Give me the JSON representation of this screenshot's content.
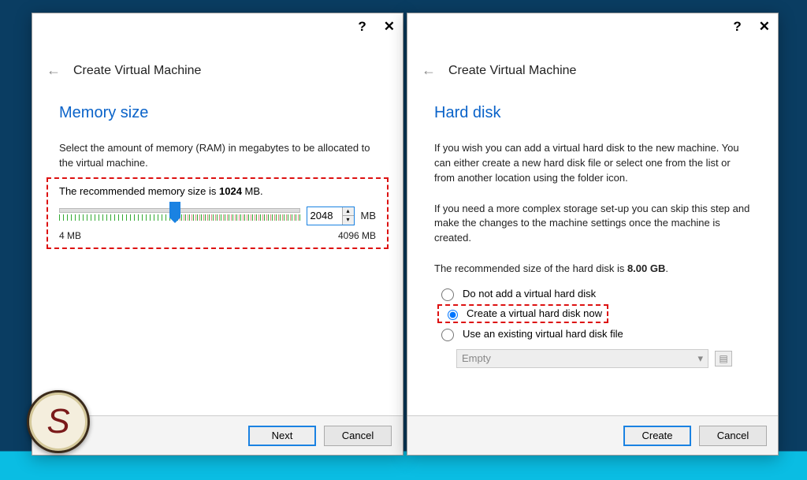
{
  "left": {
    "wizard_title": "Create Virtual Machine",
    "section_title": "Memory size",
    "instruction": "Select the amount of memory (RAM) in megabytes to be allocated to the virtual machine.",
    "recommended_prefix": "The recommended memory size is ",
    "recommended_value": "1024",
    "recommended_suffix": " MB.",
    "memory_value": "2048",
    "memory_unit": "MB",
    "slider_min": "4 MB",
    "slider_max": "4096 MB",
    "btn_next": "Next",
    "btn_cancel": "Cancel"
  },
  "right": {
    "wizard_title": "Create Virtual Machine",
    "section_title": "Hard disk",
    "para1": "If you wish you can add a virtual hard disk to the new machine. You can either create a new hard disk file or select one from the list or from another location using the folder icon.",
    "para2": "If you need a more complex storage set-up you can skip this step and make the changes to the machine settings once the machine is created.",
    "rec_prefix": "The recommended size of the hard disk is ",
    "rec_value": "8.00 GB",
    "rec_suffix": ".",
    "opt_none": "Do not add a virtual hard disk",
    "opt_create": "Create a virtual hard disk now",
    "opt_existing": "Use an existing virtual hard disk file",
    "existing_selected": "Empty",
    "btn_create": "Create",
    "btn_cancel": "Cancel"
  },
  "titlebar": {
    "help": "?",
    "close": "✕"
  }
}
